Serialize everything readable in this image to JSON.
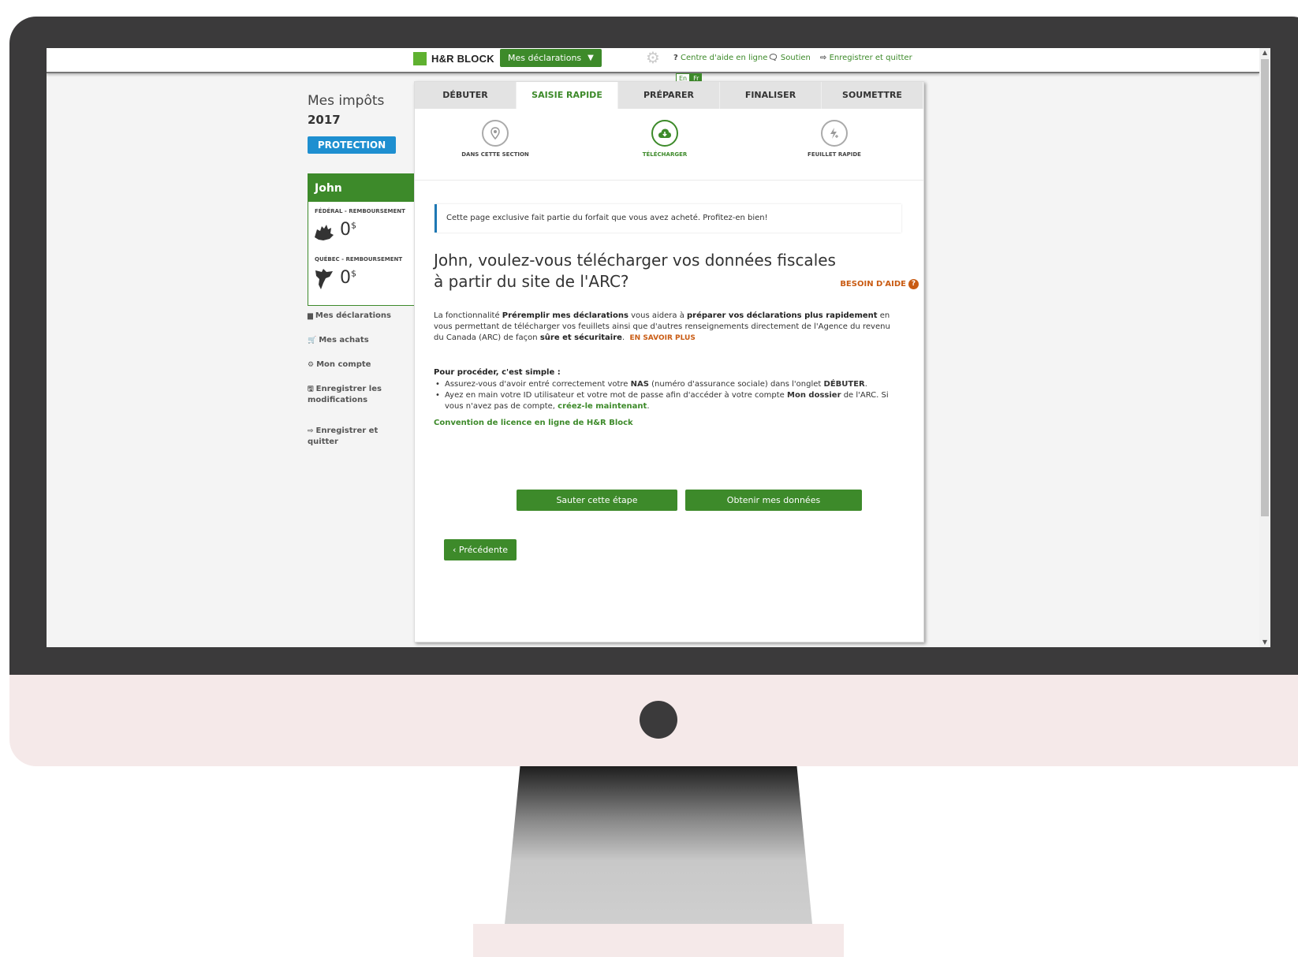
{
  "topbar": {
    "logo_text": "H&R BLOCK",
    "my_returns_label": "Mes déclarations",
    "help_center_prefix": "?",
    "help_center_label": "Centre d'aide en ligne",
    "support_label": "Soutien",
    "save_quit_label": "Enregistrer et quitter",
    "lang_en": "En",
    "lang_fr": "Fr"
  },
  "sidebar": {
    "title": "Mes impôts",
    "year": "2017",
    "badge": "PROTECTION",
    "user_name": "John",
    "federal_label": "FÉDÉRAL - REMBOURSEMENT",
    "federal_value": "0",
    "quebec_label": "QUÉBEC - REMBOURSEMENT",
    "quebec_value": "0",
    "currency": "$",
    "nav": [
      {
        "label": "Mes déclarations",
        "icon": "folder-icon"
      },
      {
        "label": "Mes achats",
        "icon": "cart-icon"
      },
      {
        "label": "Mon compte",
        "icon": "gear-icon"
      },
      {
        "label": "Enregistrer les modifications",
        "icon": "save-icon"
      },
      {
        "label": "Enregistrer et quitter",
        "icon": "exit-icon"
      }
    ]
  },
  "tabs": [
    "DÉBUTER",
    "SAISIE RAPIDE",
    "PRÉPARER",
    "FINALISER",
    "SOUMETTRE"
  ],
  "active_tab": "SAISIE RAPIDE",
  "substeps": [
    {
      "label": "DANS CETTE SECTION",
      "icon": "map-pin-icon"
    },
    {
      "label": "TÉLÉCHARGER",
      "icon": "cloud-download-icon"
    },
    {
      "label": "FEUILLET RAPIDE",
      "icon": "lightning-icon"
    }
  ],
  "main": {
    "notice": "Cette page exclusive fait partie du forfait que vous avez acheté. Profitez-en bien!",
    "heading": "John, voulez-vous télécharger vos données fiscales à partir du site de l'ARC?",
    "help_label": "BESOIN D'AIDE",
    "para_1": "La fonctionnalité",
    "para_bold_1": "Préremplir mes déclarations",
    "para_2": "vous aidera à",
    "para_bold_2": "préparer vos déclarations plus rapidement",
    "para_3": "en vous permettant de télécharger vos feuillets ainsi que d'autres renseignements directement de l'Agence du revenu du Canada (ARC) de façon",
    "para_bold_3": "sûre et sécuritaire",
    "para_4": ".",
    "learn_more": "EN SAVOIR PLUS",
    "simple_title": "Pour procéder, c'est simple :",
    "bullet_1a": "Assurez-vous d'avoir entré correctement votre",
    "bullet_1b": "NAS",
    "bullet_1c": "(numéro d'assurance sociale) dans l'onglet",
    "bullet_1d": "DÉBUTER",
    "bullet_1e": ".",
    "bullet_2a": "Ayez en main votre ID utilisateur et votre mot de passe afin d'accéder à votre compte",
    "bullet_2b": "Mon dossier",
    "bullet_2c": "de l'ARC. Si vous n'avez pas de compte,",
    "bullet_2d": "créez-le maintenant",
    "bullet_2e": ".",
    "licence_link": "Convention de licence en ligne de H&R Block",
    "skip_button": "Sauter cette étape",
    "get_data_button": "Obtenir mes données",
    "prev_button": "Précédente"
  }
}
